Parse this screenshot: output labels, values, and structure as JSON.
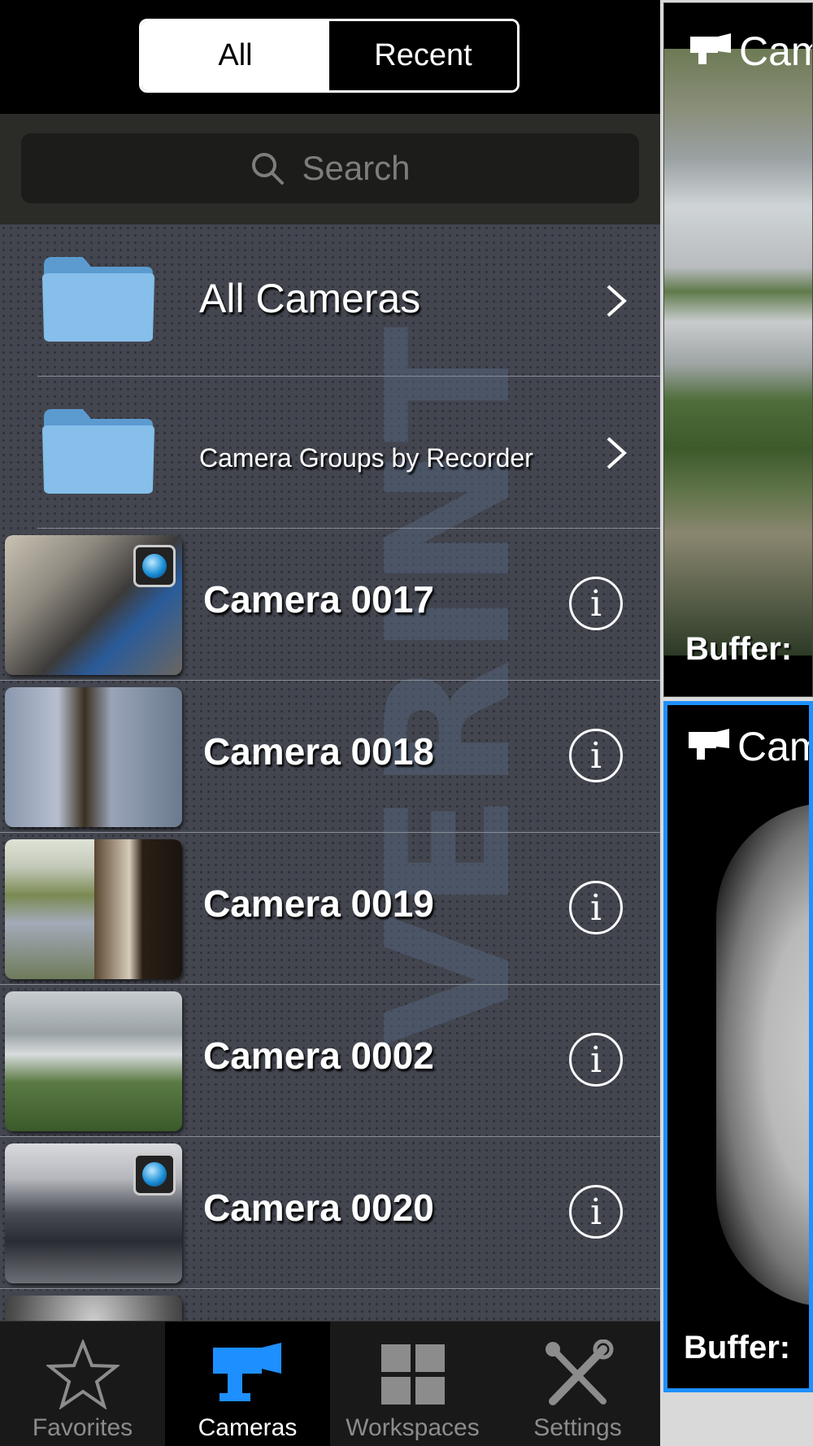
{
  "segment": {
    "all_label": "All",
    "recent_label": "Recent",
    "selected": "All"
  },
  "search": {
    "placeholder": "Search"
  },
  "watermark": "VERINT",
  "folders": [
    {
      "label": "All Cameras"
    },
    {
      "label": "Camera Groups by Recorder"
    }
  ],
  "cameras": [
    {
      "name": "Camera 0017",
      "ptz_badge": true
    },
    {
      "name": "Camera 0018",
      "ptz_badge": false
    },
    {
      "name": "Camera 0019",
      "ptz_badge": false
    },
    {
      "name": "Camera 0002",
      "ptz_badge": false
    },
    {
      "name": "Camera 0020",
      "ptz_badge": true
    }
  ],
  "tabs": [
    {
      "label": "Favorites",
      "icon": "star-icon"
    },
    {
      "label": "Cameras",
      "icon": "camera-icon",
      "active": true
    },
    {
      "label": "Workspaces",
      "icon": "grid-icon"
    },
    {
      "label": "Settings",
      "icon": "tools-icon"
    }
  ],
  "tiles": [
    {
      "title": "Cam",
      "buffer_label": "Buffer:"
    },
    {
      "title": "Cam",
      "buffer_label": "Buffer:"
    }
  ],
  "colors": {
    "accent": "#1e90ff",
    "folder": "#7fb8e6",
    "list_bg": "#43464f"
  }
}
